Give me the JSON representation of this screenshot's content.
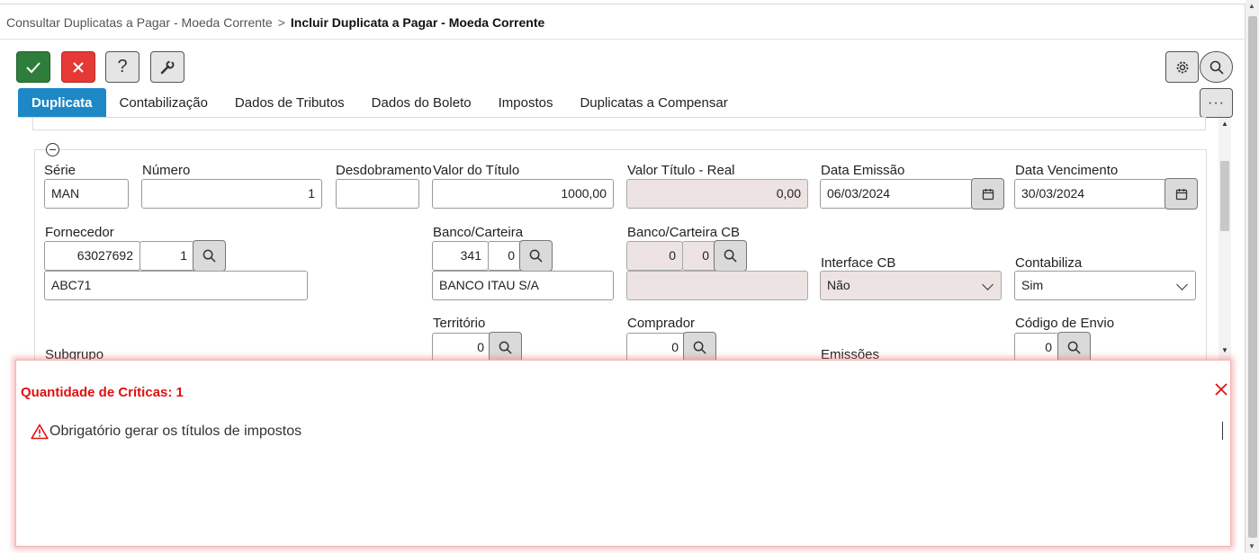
{
  "breadcrumb": {
    "parent": "Consultar Duplicatas a Pagar - Moeda Corrente",
    "separator": ">",
    "current": "Incluir Duplicata a Pagar - Moeda Corrente"
  },
  "toolbar": {
    "help_label": "?",
    "more_label": "···"
  },
  "tabs": [
    {
      "label": "Duplicata",
      "active": true
    },
    {
      "label": "Contabilização"
    },
    {
      "label": "Dados de Tributos"
    },
    {
      "label": "Dados do Boleto"
    },
    {
      "label": "Impostos"
    },
    {
      "label": "Duplicatas a Compensar"
    }
  ],
  "form": {
    "serie": {
      "label": "Série",
      "value": "MAN"
    },
    "numero": {
      "label": "Número",
      "value": "1"
    },
    "desdobramento": {
      "label": "Desdobramento",
      "value": ""
    },
    "valor_titulo": {
      "label": "Valor do Título",
      "value": "1000,00"
    },
    "valor_real": {
      "label": "Valor Título - Real",
      "value": "0,00"
    },
    "data_emissao": {
      "label": "Data Emissão",
      "value": "06/03/2024"
    },
    "data_vencimento": {
      "label": "Data Vencimento",
      "value": "30/03/2024"
    },
    "fornecedor": {
      "label": "Fornecedor",
      "codigo": "63027692",
      "loja": "1",
      "nome": "ABC71"
    },
    "banco_carteira": {
      "label": "Banco/Carteira",
      "banco": "341",
      "carteira": "0",
      "nome": "BANCO ITAU S/A"
    },
    "banco_carteira_cb": {
      "label": "Banco/Carteira CB",
      "banco": "0",
      "carteira": "0",
      "nome": ""
    },
    "interface_cb": {
      "label": "Interface CB",
      "value": "Não"
    },
    "contabiliza": {
      "label": "Contabiliza",
      "value": "Sim"
    },
    "subgrupo": {
      "label": "Subgrupo"
    },
    "territorio": {
      "label": "Território",
      "value": "0"
    },
    "comprador": {
      "label": "Comprador",
      "value": "0"
    },
    "emissoes": {
      "label": "Emissões"
    },
    "codigo_envio": {
      "label": "Código de Envio",
      "value": "0"
    }
  },
  "criticas": {
    "title": "Quantidade de Críticas: 1",
    "items": [
      "Obrigatório gerar os títulos de impostos"
    ]
  },
  "colors": {
    "ok": "#2f7d3b",
    "cancel": "#e53935",
    "tab_active": "#1e88c7",
    "critical_text": "#e01010",
    "readonly_bg": "#ede3e3"
  }
}
